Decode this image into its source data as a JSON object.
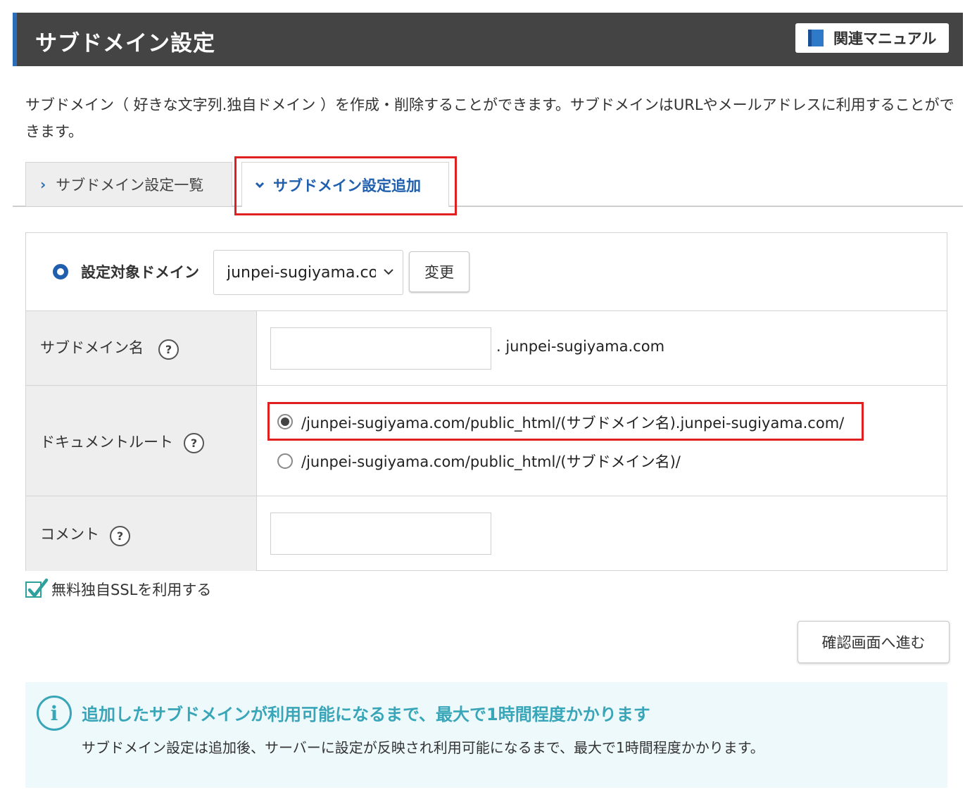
{
  "header": {
    "title": "サブドメイン設定",
    "manual_label": "関連マニュアル"
  },
  "description": "サブドメイン（ 好きな文字列.独自ドメイン ）を作成・削除することができます。サブドメインはURLやメールアドレスに利用することができます。",
  "tabs": [
    {
      "label": "サブドメイン設定一覧",
      "active": false
    },
    {
      "label": "サブドメイン設定追加",
      "active": true
    }
  ],
  "domain_select": {
    "label": "設定対象ドメイン",
    "value": "junpei-sugiyama.com",
    "change_label": "変更"
  },
  "form": {
    "subdomain": {
      "label": "サブドメイン名",
      "value": "",
      "suffix": ". junpei-sugiyama.com",
      "help": "?"
    },
    "document_root": {
      "label": "ドキュメントルート",
      "help": "?",
      "options": [
        {
          "text": "/junpei-sugiyama.com/public_html/(サブドメイン名).junpei-sugiyama.com/",
          "selected": true
        },
        {
          "text": "/junpei-sugiyama.com/public_html/(サブドメイン名)/",
          "selected": false
        }
      ]
    },
    "comment": {
      "label": "コメント",
      "value": "",
      "help": "?"
    }
  },
  "ssl": {
    "label": "無料独自SSLを利用する",
    "checked": true
  },
  "confirm_label": "確認画面へ進む",
  "notice": {
    "title": "追加したサブドメインが利用可能になるまで、最大で1時間程度かかります",
    "body": "サブドメイン設定は追加後、サーバーに設定が反映され利用可能になるまで、最大で1時間程度かかります。"
  },
  "colors": {
    "header_bg": "#444444",
    "accent_blue": "#1f5fae",
    "highlight_red": "#e02020",
    "info_teal": "#38a6b8",
    "notice_bg": "#eef9fb"
  },
  "icons": [
    "book-icon",
    "chevron-right-icon",
    "chevron-down-icon",
    "radio-bullet-icon",
    "select-caret-icon",
    "help-icon",
    "checkbox-check-icon",
    "info-icon"
  ]
}
